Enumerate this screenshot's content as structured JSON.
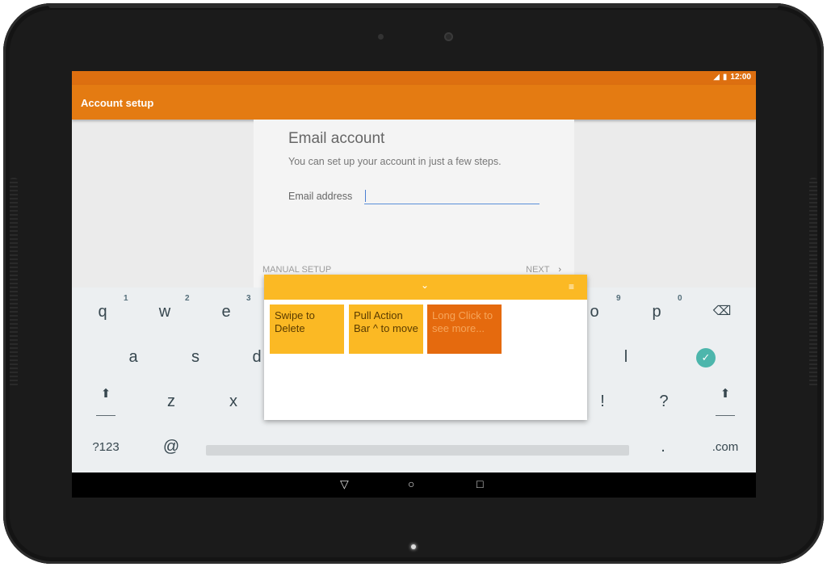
{
  "status": {
    "time": "12:00",
    "signal_icon": "signal-off-icon",
    "battery_icon": "battery-icon"
  },
  "appbar": {
    "title": "Account setup"
  },
  "setup": {
    "title": "Email account",
    "subtitle": "You can set up your account in just a few steps.",
    "email_label": "Email address",
    "email_value": "",
    "manual_setup": "MANUAL SETUP",
    "next": "NEXT",
    "next_icon": "chevron-right-icon"
  },
  "keyboard": {
    "row1": [
      "q",
      "w",
      "e",
      "o",
      "p"
    ],
    "row1_hints": [
      "1",
      "2",
      "3",
      "9",
      "0"
    ],
    "row2": [
      "a",
      "s",
      "d",
      "l"
    ],
    "row3": [
      "z",
      "x",
      "!",
      "?"
    ],
    "symbols_key": "?123",
    "at_key": "@",
    "period_key": ".",
    "dotcom_key": ".com",
    "backspace_icon": "backspace-icon",
    "enter_icon": "check-circle-icon",
    "shift_icon": "shift-icon"
  },
  "floating_window": {
    "collapse_icon": "chevron-down-icon",
    "menu_icon": "menu-icon",
    "notes": [
      "Swipe to Delete",
      "Pull Action Bar ^ to move",
      "Long Click to see more..."
    ],
    "colors": {
      "bar": "#fbb924",
      "note": "#fbb924",
      "note_active": "#e56a0e"
    }
  },
  "navbar": {
    "back_icon": "back-triangle-icon",
    "home_icon": "home-circle-icon",
    "recents_icon": "recents-square-icon"
  },
  "colors": {
    "appbar": "#e47b12",
    "statusbar": "#dd6f10",
    "accent": "#4db6ac"
  }
}
